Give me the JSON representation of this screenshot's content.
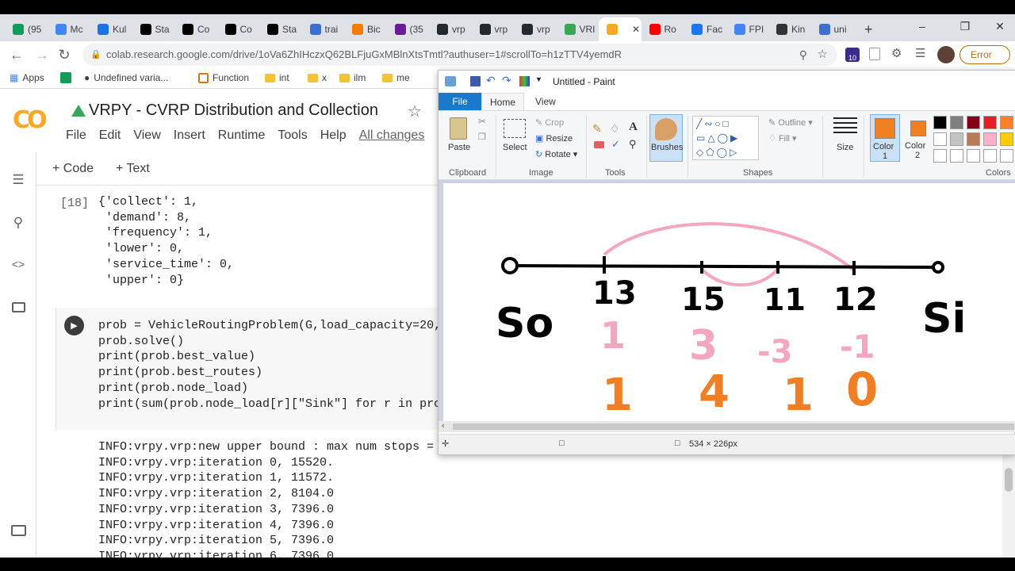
{
  "browser": {
    "tabs": [
      {
        "label": "(95",
        "color": "#0f9d58"
      },
      {
        "label": "Mc",
        "color": "#4285f4"
      },
      {
        "label": "Kul",
        "color": "#1a73e8"
      },
      {
        "label": "Sta",
        "color": "#000000"
      },
      {
        "label": "Co",
        "color": "#000000"
      },
      {
        "label": "Co",
        "color": "#000000"
      },
      {
        "label": "Sta",
        "color": "#000000"
      },
      {
        "label": "trai",
        "color": "#3b6fd4"
      },
      {
        "label": "Bic",
        "color": "#f57c00"
      },
      {
        "label": "(35",
        "color": "#6a1b9a"
      },
      {
        "label": "vrp",
        "color": "#24292e"
      },
      {
        "label": "vrp",
        "color": "#24292e"
      },
      {
        "label": "vrp",
        "color": "#24292e"
      },
      {
        "label": "VRI",
        "color": "#34a853"
      },
      {
        "label": "",
        "color": "#f9a825"
      },
      {
        "label": "Ro",
        "color": "#ff0000"
      },
      {
        "label": "Fac",
        "color": "#1877f2"
      },
      {
        "label": "FPI",
        "color": "#4285f4"
      },
      {
        "label": "Kin",
        "color": "#333333"
      },
      {
        "label": "uni",
        "color": "#3b6fd4"
      }
    ],
    "new_tab": "+",
    "url": "colab.research.google.com/drive/1oVa6ZhIHczxQ62BLFjuGxMBlnXtsTmtl?authuser=1#scrollTo=h1zTTV4yemdR",
    "error_label": "Error",
    "bookmarks": [
      "Apps",
      "Undefined varia...",
      "Function",
      "int",
      "x",
      "ilm",
      "me"
    ]
  },
  "colab": {
    "title": "VRPY - CVRP Distribution and Collection",
    "menu": [
      "File",
      "Edit",
      "View",
      "Insert",
      "Runtime",
      "Tools",
      "Help"
    ],
    "all_changes": "All changes",
    "add_code": "+ Code",
    "add_text": "+ Text",
    "output_prompt": "[18]",
    "output_lines": [
      "{'collect': 1,",
      " 'demand': 8,",
      " 'frequency': 1,",
      " 'lower': 0,",
      " 'service_time': 0,",
      " 'upper': 0}"
    ],
    "code_lines": [
      "prob = VehicleRoutingProblem(G,load_capacity=20,",
      "prob.solve()",
      "print(prob.best_value)",
      "print(prob.best_routes)",
      "print(prob.node_load)",
      "print(sum(prob.node_load[r][\"Sink\"] for r in pro"
    ],
    "log_lines": [
      "INFO:vrpy.vrp:new upper bound : max num stops =",
      "INFO:vrpy.vrp:iteration 0, 15520.",
      "INFO:vrpy.vrp:iteration 1, 11572.",
      "INFO:vrpy.vrp:iteration 2, 8104.0",
      "INFO:vrpy.vrp:iteration 3, 7396.0",
      "INFO:vrpy.vrp:iteration 4, 7396.0",
      "INFO:vrpy.vrp:iteration 5, 7396.0",
      "INFO:vrpy.vrp:iteration 6, 7396.0"
    ]
  },
  "paint": {
    "title": "Untitled - Paint",
    "tabs": {
      "file": "File",
      "home": "Home",
      "view": "View"
    },
    "clipboard": {
      "paste": "Paste",
      "group": "Clipboard"
    },
    "image": {
      "select": "Select",
      "crop": "Crop",
      "resize": "Resize",
      "rotate": "Rotate",
      "group": "Image"
    },
    "tools_group": "Tools",
    "brushes": "Brushes",
    "shapes": {
      "outline": "Outline",
      "fill": "Fill",
      "group": "Shapes"
    },
    "size": "Size",
    "color1": "Color\n1",
    "color1_a": "Color",
    "color1_b": "1",
    "color2_a": "Color",
    "color2_b": "2",
    "colors_group": "Colors",
    "status_size": "534 × 226px",
    "palette": [
      "#000000",
      "#7f7f7f",
      "#880015",
      "#ed1c24",
      "#ff7f27",
      "#ffffff",
      "#c3c3c3",
      "#b97a57",
      "#ffaec9",
      "#ffc90e"
    ],
    "drawing": {
      "nodes": [
        "So",
        "13",
        "15",
        "11",
        "12",
        "Si"
      ],
      "pink_values": [
        "1",
        "3",
        "-3",
        "-1"
      ],
      "orange_values": [
        "1",
        "4",
        "1",
        "0"
      ],
      "colors": {
        "line": "#000000",
        "pink": "#f4a6c1",
        "orange": "#f07f22"
      }
    }
  }
}
